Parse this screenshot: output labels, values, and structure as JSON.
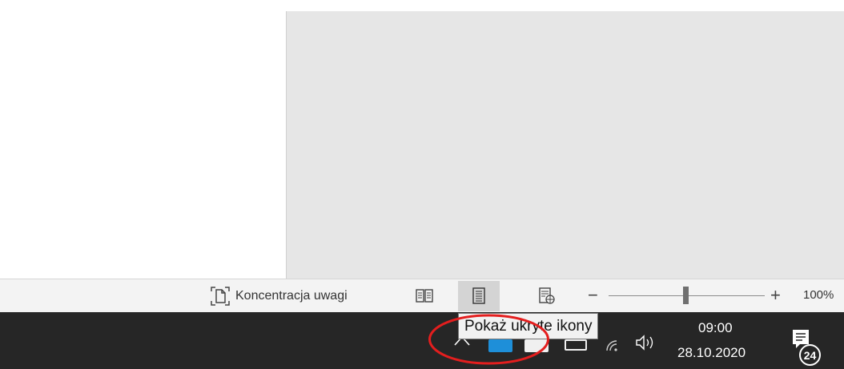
{
  "statusbar": {
    "focus_label": "Koncentracja uwagi",
    "zoom_minus": "−",
    "zoom_plus": "+",
    "zoom_level": "100%",
    "zoom_fraction": 0.5,
    "view_buttons": [
      {
        "name": "read-mode",
        "icon": "book-icon",
        "active": false
      },
      {
        "name": "print-layout",
        "icon": "page-icon",
        "active": true
      },
      {
        "name": "web-layout",
        "icon": "web-page-icon",
        "active": false
      }
    ]
  },
  "taskbar": {
    "tooltip": "Pokaż ukryte ikony",
    "time": "09:00",
    "date": "28.10.2020",
    "notification_count": "24",
    "colors": {
      "taskbar": "#262626",
      "onedrive": "#1e8fd9",
      "highlight": "#e41e1e"
    }
  }
}
